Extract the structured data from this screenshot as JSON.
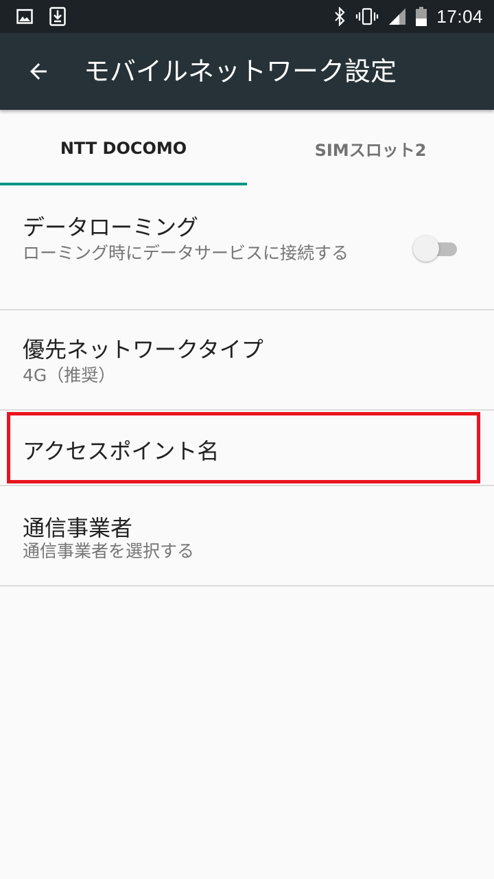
{
  "status_bar": {
    "time": "17:04",
    "left_icons": [
      "image-icon",
      "download-icon"
    ],
    "right_icons": [
      "bluetooth-icon",
      "vibrate-icon",
      "signal-icon",
      "battery-icon"
    ]
  },
  "app_bar": {
    "title": "モバイルネットワーク設定",
    "back_icon": "arrow-back-icon",
    "background": "#263238"
  },
  "tabs": [
    {
      "label": "NTT DOCOMO",
      "selected": true
    },
    {
      "label": "SIMスロット2",
      "selected": false
    }
  ],
  "accent_color": "#009688",
  "highlight_color": "#e8141e",
  "preferences": {
    "data_roaming": {
      "title": "データローミング",
      "summary": "ローミング時にデータサービスに接続する",
      "enabled": false
    },
    "preferred_network": {
      "title": "優先ネットワークタイプ",
      "summary": "4G（推奨）"
    },
    "apn": {
      "title": "アクセスポイント名"
    },
    "carrier": {
      "title": "通信事業者",
      "summary": "通信事業者を選択する"
    }
  }
}
